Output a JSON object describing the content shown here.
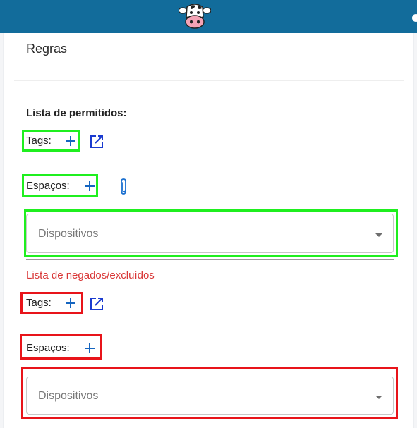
{
  "header": {
    "logo_icon": "cow-logo-icon",
    "bar_color": "#126c9b"
  },
  "card": {
    "title": "Regras"
  },
  "allow_list": {
    "label": "Lista de permitidos:",
    "tags_label": "Tags:",
    "spaces_label": "Espaços:",
    "devices_placeholder": "Dispositivos",
    "highlight_color": "#1fef1f"
  },
  "deny_list": {
    "label": "Lista de negados/excluídos",
    "label_color": "#d93636",
    "tags_label": "Tags:",
    "spaces_label": "Espaços:",
    "devices_placeholder": "Dispositivos",
    "highlight_color": "#e8141a"
  },
  "icons": {
    "add": "plus-icon",
    "open_external": "open-in-new-icon",
    "attach": "paperclip-icon",
    "dropdown": "caret-down-icon"
  }
}
